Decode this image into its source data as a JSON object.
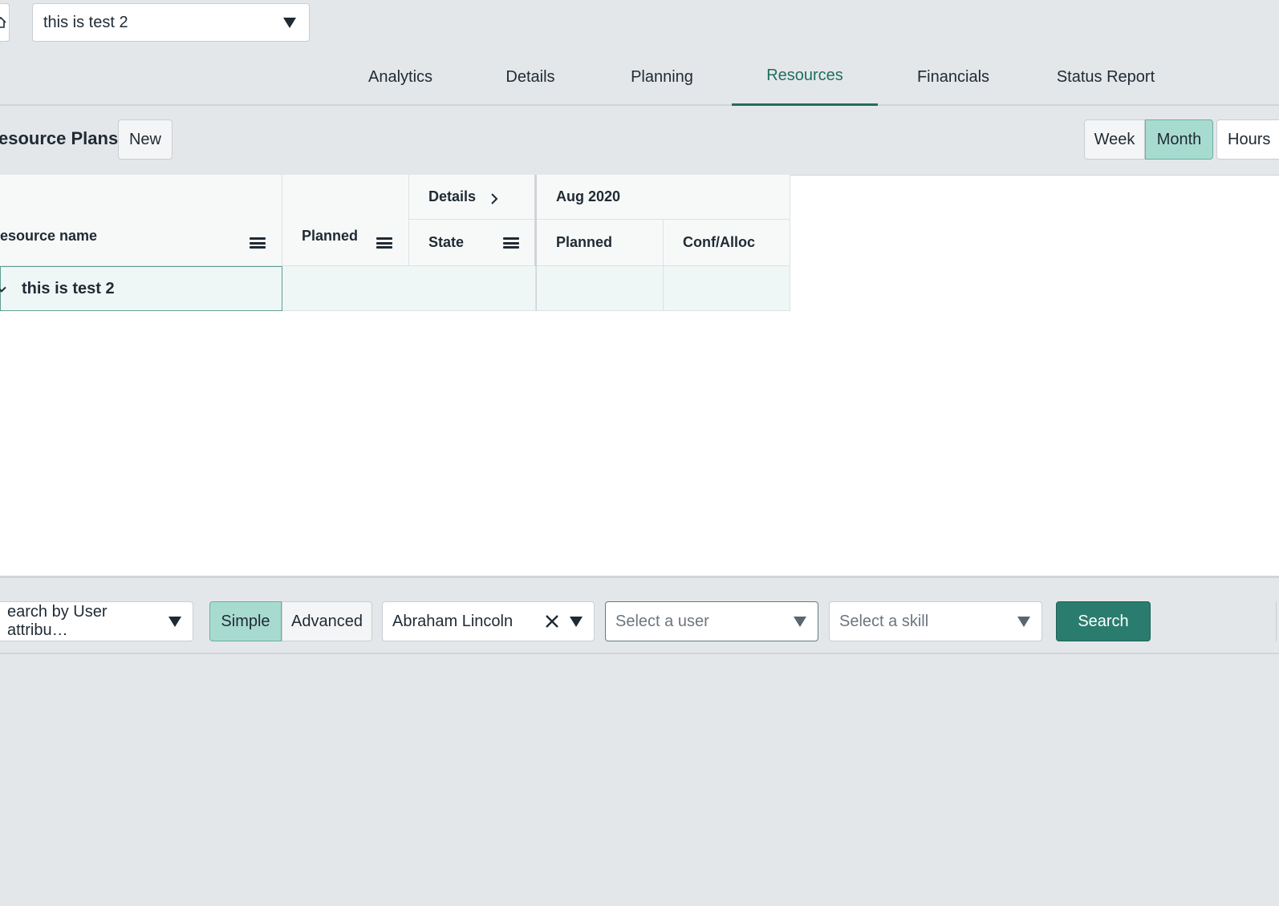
{
  "header": {
    "project_select_value": "this is test 2"
  },
  "tabs": [
    {
      "label": "Analytics"
    },
    {
      "label": "Details"
    },
    {
      "label": "Planning"
    },
    {
      "label": "Resources",
      "active": true
    },
    {
      "label": "Financials"
    },
    {
      "label": "Status Report"
    }
  ],
  "plans": {
    "title": "esource Plans",
    "new_label": "New",
    "view_week": "Week",
    "view_month": "Month",
    "unit_label": "Hours"
  },
  "grid": {
    "col_resource_name": "esource name",
    "col_planned": "Planned",
    "group_details": "Details",
    "col_state": "State",
    "group_period": "Aug 2020",
    "col_period_planned": "Planned",
    "col_conf_alloc": "Conf/Alloc",
    "rows": [
      {
        "name": "this is test 2"
      }
    ]
  },
  "search": {
    "attribute_select": "earch by User attribu…",
    "mode_simple": "Simple",
    "mode_advanced": "Advanced",
    "user_value": "Abraham Lincoln",
    "select_user_placeholder": "Select a user",
    "select_skill_placeholder": "Select a skill",
    "search_label": "Search"
  },
  "colors": {
    "accent": "#1f6f5f",
    "toggle_active": "#a8dbd0",
    "search_button": "#2a7d6e"
  }
}
